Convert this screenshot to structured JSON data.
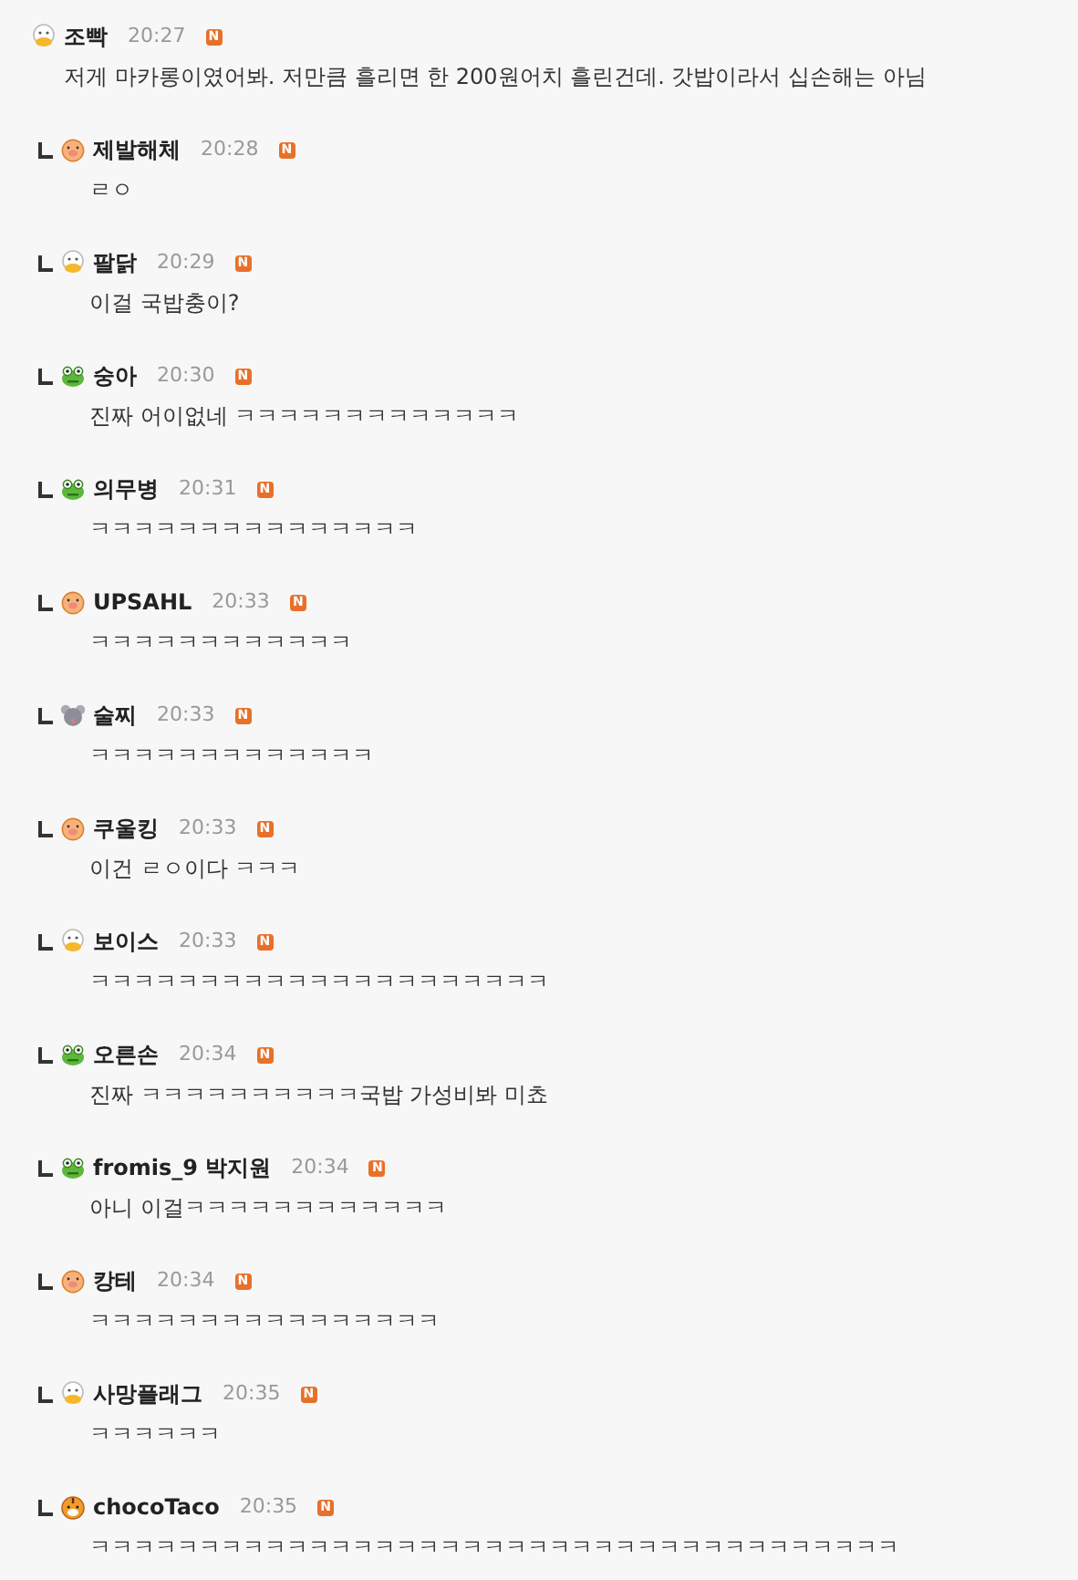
{
  "comments": [
    {
      "reply": false,
      "kind": "duck",
      "name": "조빡",
      "time": "20:27",
      "badge": "N",
      "text": "저게 마카롱이였어봐. 저만큼 흘리면 한 200원어치 흘린건데. 갓밥이라서 십손해는 아님"
    },
    {
      "reply": true,
      "kind": "pig",
      "name": "제발해체",
      "time": "20:28",
      "badge": "N",
      "text": "ㄹㅇ"
    },
    {
      "reply": true,
      "kind": "duck",
      "name": "팔닭",
      "time": "20:29",
      "badge": "N",
      "text": "이걸 국밥충이?"
    },
    {
      "reply": true,
      "kind": "frog",
      "name": "숭아",
      "time": "20:30",
      "badge": "N",
      "text": "진짜 어이없네 ㅋㅋㅋㅋㅋㅋㅋㅋㅋㅋㅋㅋㅋ"
    },
    {
      "reply": true,
      "kind": "frog",
      "name": "의무병",
      "time": "20:31",
      "badge": "N",
      "text": "ㅋㅋㅋㅋㅋㅋㅋㅋㅋㅋㅋㅋㅋㅋㅋ"
    },
    {
      "reply": true,
      "kind": "pig",
      "name": "UPSAHL",
      "time": "20:33",
      "badge": "N",
      "text": "ㅋㅋㅋㅋㅋㅋㅋㅋㅋㅋㅋㅋ"
    },
    {
      "reply": true,
      "kind": "mouse",
      "name": "술찌",
      "time": "20:33",
      "badge": "N",
      "text": "ㅋㅋㅋㅋㅋㅋㅋㅋㅋㅋㅋㅋㅋ"
    },
    {
      "reply": true,
      "kind": "pig",
      "name": "쿠울킹",
      "time": "20:33",
      "badge": "N",
      "text": "이건 ㄹㅇ이다 ㅋㅋㅋ"
    },
    {
      "reply": true,
      "kind": "duck",
      "name": "보이스",
      "time": "20:33",
      "badge": "N",
      "text": "ㅋㅋㅋㅋㅋㅋㅋㅋㅋㅋㅋㅋㅋㅋㅋㅋㅋㅋㅋㅋㅋ"
    },
    {
      "reply": true,
      "kind": "frog",
      "name": "오른손",
      "time": "20:34",
      "badge": "N",
      "text": "진짜 ㅋㅋㅋㅋㅋㅋㅋㅋㅋㅋ국밥 가성비봐 미쵸"
    },
    {
      "reply": true,
      "kind": "frog",
      "name": "fromis_9 박지원",
      "time": "20:34",
      "badge": "N",
      "text": "아니 이걸ㅋㅋㅋㅋㅋㅋㅋㅋㅋㅋㅋㅋ"
    },
    {
      "reply": true,
      "kind": "pig",
      "name": "캉테",
      "time": "20:34",
      "badge": "N",
      "text": "ㅋㅋㅋㅋㅋㅋㅋㅋㅋㅋㅋㅋㅋㅋㅋㅋ"
    },
    {
      "reply": true,
      "kind": "duck",
      "name": "사망플래그",
      "time": "20:35",
      "badge": "N",
      "text": "ㅋㅋㅋㅋㅋㅋ"
    },
    {
      "reply": true,
      "kind": "tiger",
      "name": "chocoTaco",
      "time": "20:35",
      "badge": "N",
      "text": "ㅋㅋㅋㅋㅋㅋㅋㅋㅋㅋㅋㅋㅋㅋㅋㅋㅋㅋㅋㅋㅋㅋㅋㅋㅋㅋㅋㅋㅋㅋㅋㅋㅋㅋㅋㅋㅋ"
    }
  ]
}
